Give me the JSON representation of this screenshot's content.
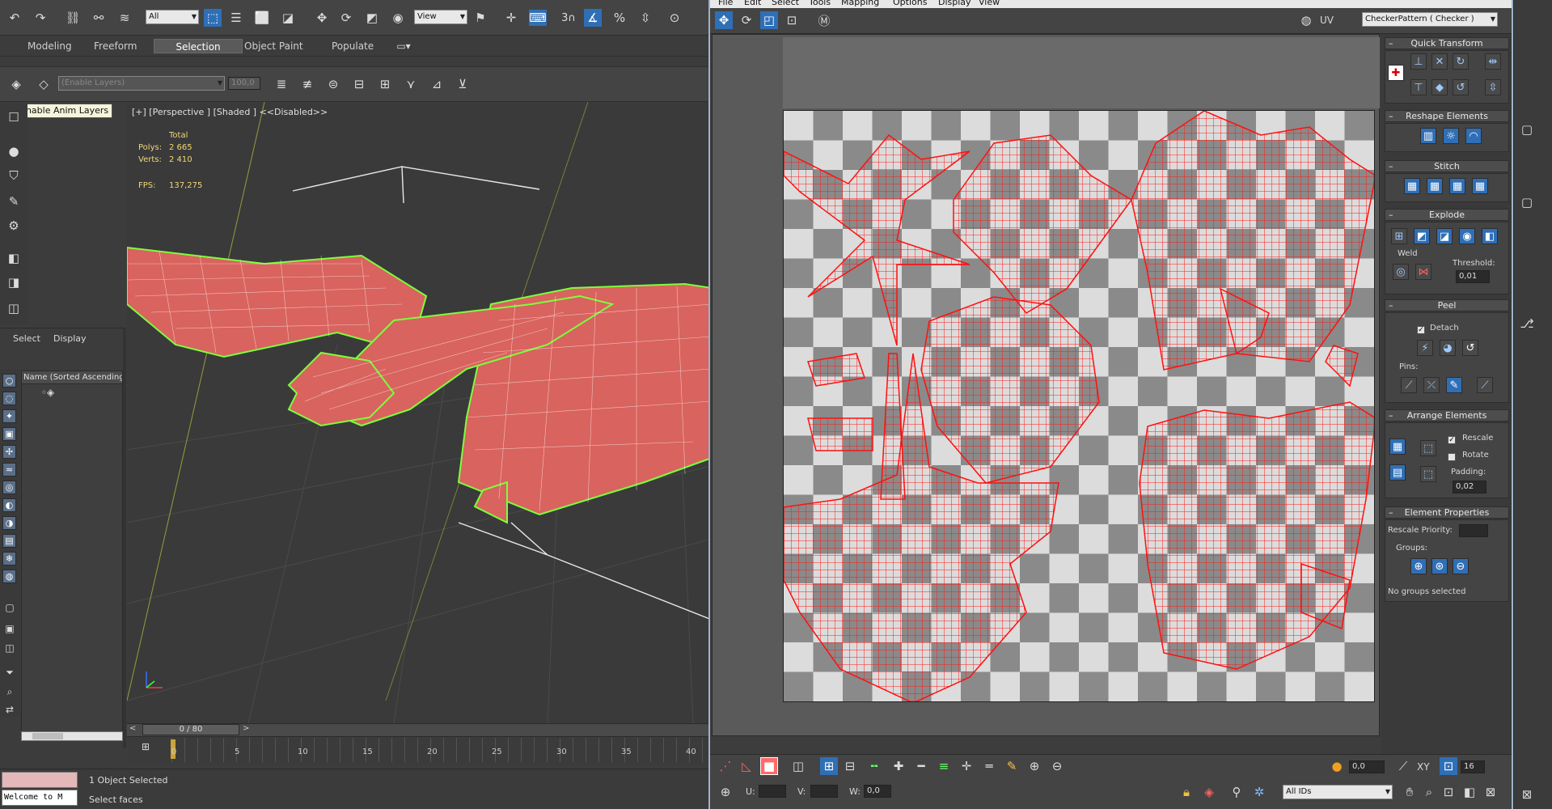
{
  "toolbar": {
    "selection_filter": "All",
    "reference_coord": "View",
    "snap_label": "3"
  },
  "ribbon": {
    "tabs": [
      {
        "label": "Modeling"
      },
      {
        "label": "Freeform"
      },
      {
        "label": "Selection"
      },
      {
        "label": "Object Paint"
      },
      {
        "label": "Populate"
      }
    ],
    "active_tab": "Selection"
  },
  "anim_layers": {
    "layer_dropdown": "(Enable Layers)",
    "weight_value": "100,0",
    "tooltip": "Enable Anim Layers"
  },
  "viewport": {
    "label": "[+] [Perspective ] [Shaded ] <<Disabled>>",
    "stats": {
      "total_header": "Total",
      "polys_label": "Polys:",
      "polys_value": "2 665",
      "verts_label": "Verts:",
      "verts_value": "2 410",
      "fps_label": "FPS:",
      "fps_value": "137,275"
    }
  },
  "scene_explorer": {
    "menu_select": "Select",
    "menu_display": "Display",
    "column_header": "Name (Sorted Ascending)"
  },
  "timeline": {
    "frame_display": "0 / 80",
    "ticks": [
      "0",
      "5",
      "10",
      "15",
      "20",
      "25",
      "30",
      "35",
      "40"
    ]
  },
  "status": {
    "maxscript_text": "Welcome to M",
    "selection_info": "1 Object Selected",
    "prompt": "Select faces"
  },
  "uv_editor": {
    "menu": [
      {
        "label": "File"
      },
      {
        "label": "Edit"
      },
      {
        "label": "Select"
      },
      {
        "label": "Tools"
      },
      {
        "label": "Mapping"
      },
      {
        "label": "Options"
      },
      {
        "label": "Display"
      },
      {
        "label": "View"
      }
    ],
    "uv_label": "UV",
    "texture_dropdown": "CheckerPattern  ( Checker )",
    "bottom": {
      "value_1": "0,0",
      "xy_label": "XY",
      "zoom_value": "16",
      "u_label": "U:",
      "v_label": "V:",
      "w_label": "W:",
      "w_value": "0,0",
      "ids_dropdown": "All IDs"
    },
    "panel": {
      "quick_transform": "Quick Transform",
      "reshape": "Reshape Elements",
      "stitch": "Stitch",
      "explode": "Explode",
      "weld": "Weld",
      "threshold_label": "Threshold:",
      "threshold_value": "0,01",
      "peel": "Peel",
      "detach_label": "Detach",
      "pins_label": "Pins:",
      "arrange": "Arrange Elements",
      "rescale_label": "Rescale",
      "rotate_label": "Rotate",
      "padding_label": "Padding:",
      "padding_value": "0,02",
      "element_props": "Element Properties",
      "rescale_priority": "Rescale Priority:",
      "groups_label": "Groups:",
      "no_groups": "No groups selected"
    }
  }
}
